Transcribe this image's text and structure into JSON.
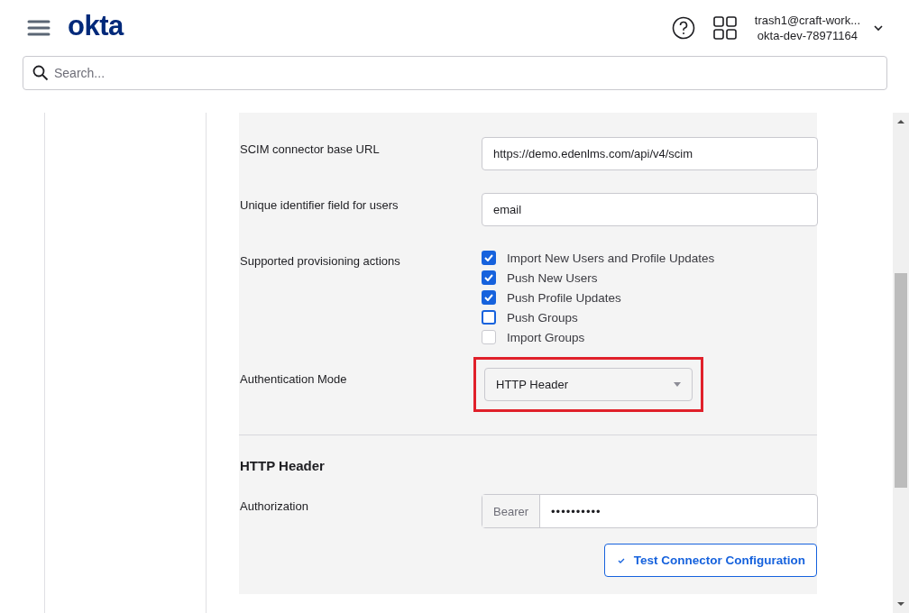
{
  "header": {
    "logo": "okta",
    "account": {
      "email": "trash1@craft-work...",
      "org": "okta-dev-78971164"
    }
  },
  "search": {
    "placeholder": "Search..."
  },
  "form": {
    "fields": [
      {
        "kind": "text",
        "label": "SCIM connector base URL",
        "value": "https://demo.edenlms.com/api/v4/scim"
      },
      {
        "kind": "text",
        "label": "Unique identifier field for users",
        "value": "email"
      },
      {
        "kind": "checkboxes",
        "label": "Supported provisioning actions",
        "options": [
          {
            "label": "Import New Users and Profile Updates",
            "checked": true,
            "disabled": false
          },
          {
            "label": "Push New Users",
            "checked": true,
            "disabled": false
          },
          {
            "label": "Push Profile Updates",
            "checked": true,
            "disabled": false
          },
          {
            "label": "Push Groups",
            "checked": false,
            "disabled": false
          },
          {
            "label": "Import Groups",
            "checked": false,
            "disabled": true
          }
        ]
      },
      {
        "kind": "select",
        "label": "Authentication Mode",
        "value": "HTTP Header",
        "highlighted": true
      }
    ],
    "section_title": "HTTP Header",
    "authorization": {
      "label": "Authorization",
      "prefix": "Bearer",
      "value": "••••••••••"
    },
    "test_button": "Test Connector Configuration"
  }
}
